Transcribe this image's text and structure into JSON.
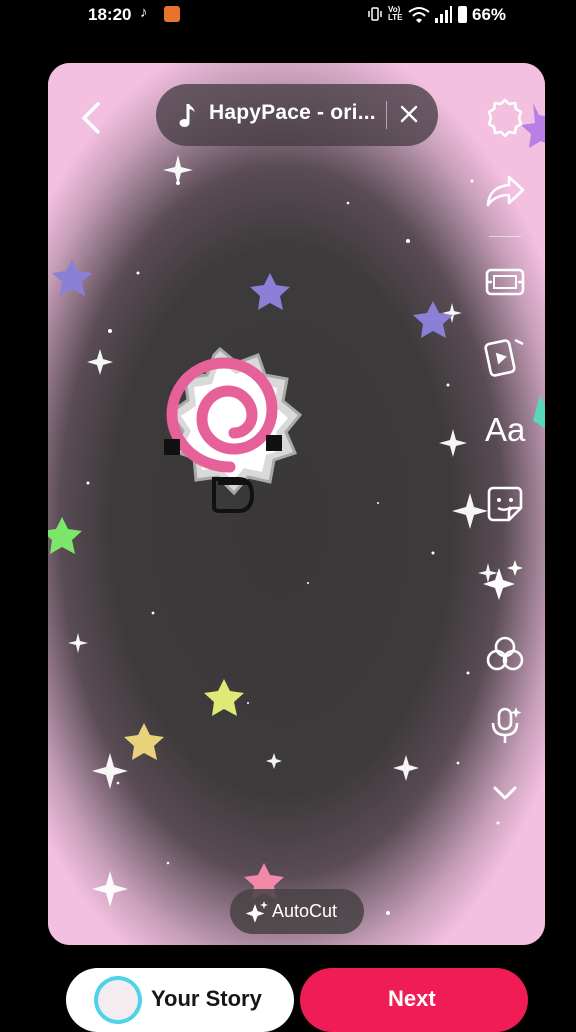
{
  "status_bar": {
    "time": "18:20",
    "tiktok_glyph": "♪",
    "volte_text": "Vo)\nLTE",
    "battery": "66%"
  },
  "music": {
    "title": "HapyPace - ori..."
  },
  "toolbar": {
    "text_tool_label": "Aa",
    "icons": [
      "settings-icon",
      "share-icon",
      "flip-icon",
      "templates-icon",
      "text-icon",
      "sticker-icon",
      "effects-icon",
      "filters-icon",
      "voice-icon",
      "more-icon"
    ]
  },
  "autocut": {
    "label": "AutoCut"
  },
  "actions": {
    "story_label": "Your Story",
    "next_label": "Next"
  },
  "colors": {
    "accent": "#ef1c55",
    "frame_pink": "#f2bedd",
    "story_ring": "#4fd3e8"
  }
}
